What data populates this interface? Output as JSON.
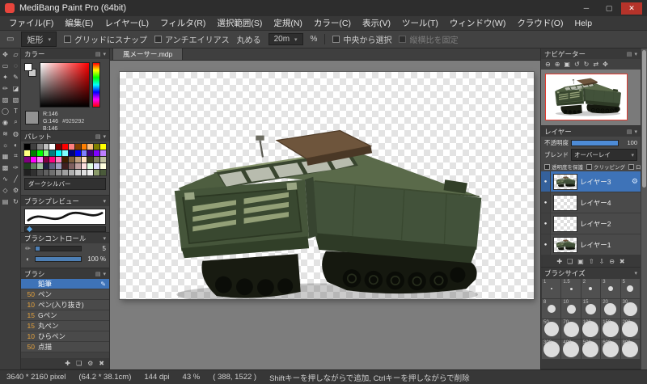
{
  "window": {
    "title": "MediBang Paint Pro (64bit)",
    "minimize": "─",
    "maximize": "▢",
    "close": "✕"
  },
  "menubar": {
    "items": [
      "ファイル(F)",
      "編集(E)",
      "レイヤー(L)",
      "フィルタ(R)",
      "選択範囲(S)",
      "定規(N)",
      "カラー(C)",
      "表示(V)",
      "ツール(T)",
      "ウィンドウ(W)",
      "クラウド(O)",
      "Help"
    ]
  },
  "toolbar": {
    "shape_label": "矩形",
    "snap_label": "グリッドにスナップ",
    "antialias_label": "アンチエイリアス",
    "round_label": "丸める",
    "round_value": "20m",
    "percent_label": "%",
    "center_label": "中央から選択",
    "aspect_label": "縦横比を固定"
  },
  "glyphs": {
    "panel_menu": "▤",
    "panel_collapse": "▾",
    "caret": "▾",
    "eye_dot": "●",
    "gear": "⚙",
    "brush_edit": "✎"
  },
  "tools": {
    "items": [
      {
        "name": "move-tool-icon",
        "glyph": "✥"
      },
      {
        "name": "transform-tool-icon",
        "glyph": "▱"
      },
      {
        "name": "select-rect-tool-icon",
        "glyph": "▭"
      },
      {
        "name": "lasso-tool-icon",
        "glyph": "◌"
      },
      {
        "name": "magic-wand-tool-icon",
        "glyph": "✦"
      },
      {
        "name": "pen-tool-icon",
        "glyph": "✎"
      },
      {
        "name": "pencil-tool-icon",
        "glyph": "✏"
      },
      {
        "name": "eraser-tool-icon",
        "glyph": "◪"
      },
      {
        "name": "bucket-tool-icon",
        "glyph": "▨"
      },
      {
        "name": "gradient-tool-icon",
        "glyph": "▧"
      },
      {
        "name": "shape-tool-icon",
        "glyph": "◯"
      },
      {
        "name": "text-tool-icon",
        "glyph": "T"
      },
      {
        "name": "eyedropper-tool-icon",
        "glyph": "◉"
      },
      {
        "name": "zoom-tool-icon",
        "glyph": "⌕"
      },
      {
        "name": "airbrush-tool-icon",
        "glyph": "≋"
      },
      {
        "name": "blur-tool-icon",
        "glyph": "◍"
      },
      {
        "name": "dodge-tool-icon",
        "glyph": "☼"
      },
      {
        "name": "burn-tool-icon",
        "glyph": "◐"
      },
      {
        "name": "grid-tool-icon",
        "glyph": "▦"
      },
      {
        "name": "snap-tool-icon",
        "glyph": "⌗"
      },
      {
        "name": "material-tool-icon",
        "glyph": "▩"
      },
      {
        "name": "script-tool-icon",
        "glyph": "✑"
      },
      {
        "name": "curve-tool-icon",
        "glyph": "∿"
      },
      {
        "name": "line-tool-icon",
        "glyph": "╱"
      },
      {
        "name": "polygon-tool-icon",
        "glyph": "◇"
      },
      {
        "name": "settings-tool-icon",
        "glyph": "⚙"
      },
      {
        "name": "panel-tool-icon",
        "glyph": "▤"
      },
      {
        "name": "rotate-tool-icon",
        "glyph": "↻"
      }
    ]
  },
  "color_panel": {
    "title": "カラー",
    "r": "R:146",
    "g": "G:146",
    "b": "B:146",
    "hex": "#929292",
    "current": "#929292"
  },
  "palette": {
    "title": "パレット",
    "selected_name": "ダークシルバー",
    "colors": [
      "#000000",
      "#404040",
      "#808080",
      "#c0c0c0",
      "#ffffff",
      "#7f0000",
      "#ff0000",
      "#ff7f7f",
      "#7f3f00",
      "#ff7f00",
      "#ffbf7f",
      "#7f7f00",
      "#ffff00",
      "#ffff7f",
      "#007f00",
      "#00ff00",
      "#7fff7f",
      "#007f7f",
      "#00ffff",
      "#7fffff",
      "#00007f",
      "#0000ff",
      "#7f7fff",
      "#3f007f",
      "#7f00ff",
      "#bf7fff",
      "#7f007f",
      "#ff00ff",
      "#ff7fff",
      "#7f0040",
      "#ff0080",
      "#ff7fbf",
      "#3f1f00",
      "#7f5f3f",
      "#bf9f7f",
      "#ffdfbf",
      "#3f3f1f",
      "#7f7f5f",
      "#bfbf9f",
      "#1f3f1f",
      "#5f7f5f",
      "#9fbf9f",
      "#1f1f3f",
      "#5f5f7f",
      "#9f9fbf",
      "#3f1f1f",
      "#7f5f5f",
      "#bf9f9f",
      "#ffe0e0",
      "#e0ffe0",
      "#e0e0ff",
      "#ffffe0",
      "#202020",
      "#303030",
      "#505050",
      "#606060",
      "#707070",
      "#909090",
      "#a0a0a0",
      "#b0b0b0",
      "#d0d0d0",
      "#e0e0e0",
      "#f0f0f0",
      "#8a9a6a",
      "#4a5a3a"
    ]
  },
  "brush_preview": {
    "title": "ブラシプレビュー"
  },
  "brush_control": {
    "title": "ブラシコントロール",
    "size_value": "5",
    "opacity_value": "100 %"
  },
  "brushes": {
    "title": "ブラシ",
    "items": [
      {
        "size": "",
        "name": "鉛筆",
        "selected": true
      },
      {
        "size": "50",
        "name": "ペン"
      },
      {
        "size": "10",
        "name": "ペン(入り抜き)"
      },
      {
        "size": "15",
        "name": "Gペン"
      },
      {
        "size": "15",
        "name": "丸ペン"
      },
      {
        "size": "10",
        "name": "ひらペン"
      },
      {
        "size": "50",
        "name": "点描"
      }
    ],
    "footer_icons": [
      {
        "name": "add-brush-icon",
        "glyph": "✚"
      },
      {
        "name": "duplicate-brush-icon",
        "glyph": "❏"
      },
      {
        "name": "brush-settings-icon",
        "glyph": "⚙"
      },
      {
        "name": "delete-brush-icon",
        "glyph": "✖"
      }
    ]
  },
  "canvas": {
    "tab": "風メーサー.mdp"
  },
  "navigator": {
    "title": "ナビゲーター",
    "icons": [
      {
        "name": "zoom-out-icon",
        "glyph": "⊖"
      },
      {
        "name": "zoom-in-icon",
        "glyph": "⊕"
      },
      {
        "name": "fit-view-icon",
        "glyph": "▣"
      },
      {
        "name": "rotate-left-icon",
        "glyph": "↺"
      },
      {
        "name": "rotate-right-icon",
        "glyph": "↻"
      },
      {
        "name": "flip-view-icon",
        "glyph": "⇄"
      },
      {
        "name": "reset-view-icon",
        "glyph": "✥"
      }
    ]
  },
  "layers": {
    "title": "レイヤー",
    "opacity_label": "不透明度",
    "opacity_value": "100",
    "blend_label": "ブレンド",
    "blend_value": "オーバーレイ",
    "protect_label": "透明度を保護",
    "clip_label": "クリッピング",
    "lock_label": "ロック",
    "items": [
      {
        "name": "レイヤー3",
        "selected": true,
        "thumb": "tank"
      },
      {
        "name": "レイヤー4",
        "selected": false,
        "thumb": "blank"
      },
      {
        "name": "レイヤー2",
        "selected": false,
        "thumb": "blank"
      },
      {
        "name": "レイヤー1",
        "selected": false,
        "thumb": "tank"
      }
    ],
    "footer_icons": [
      {
        "name": "add-layer-icon",
        "glyph": "✚"
      },
      {
        "name": "duplicate-layer-icon",
        "glyph": "❏"
      },
      {
        "name": "new-folder-icon",
        "glyph": "▣"
      },
      {
        "name": "move-layer-up-icon",
        "glyph": "⇧"
      },
      {
        "name": "move-layer-down-icon",
        "glyph": "⇩"
      },
      {
        "name": "merge-layer-icon",
        "glyph": "⊖"
      },
      {
        "name": "delete-layer-icon",
        "glyph": "✖"
      }
    ]
  },
  "brush_size": {
    "title": "ブラシサイズ",
    "items": [
      {
        "label": "1",
        "d": 2
      },
      {
        "label": "1.5",
        "d": 3
      },
      {
        "label": "2",
        "d": 4
      },
      {
        "label": "3",
        "d": 6
      },
      {
        "label": "5",
        "d": 8
      },
      {
        "label": "8",
        "d": 10
      },
      {
        "label": "10",
        "d": 11
      },
      {
        "label": "15",
        "d": 13
      },
      {
        "label": "20",
        "d": 15
      },
      {
        "label": "30",
        "d": 17
      },
      {
        "label": "50",
        "d": 18
      },
      {
        "label": "70",
        "d": 19
      },
      {
        "label": "100",
        "d": 20
      },
      {
        "label": "150",
        "d": 20
      },
      {
        "label": "200",
        "d": 20
      },
      {
        "label": "300",
        "d": 20
      },
      {
        "label": "400",
        "d": 20
      },
      {
        "label": "500",
        "d": 20
      },
      {
        "label": "600",
        "d": 20
      },
      {
        "label": "800",
        "d": 20
      }
    ]
  },
  "status": {
    "size": "3640 * 2160 pixel",
    "dimensions": "(64.2 * 38.1cm)",
    "dpi": "144 dpi",
    "zoom": "43 %",
    "coords": "( 388, 1522 )",
    "hint": "Shiftキーを押しながらで追加, Ctrlキーを押しながらで削除"
  }
}
